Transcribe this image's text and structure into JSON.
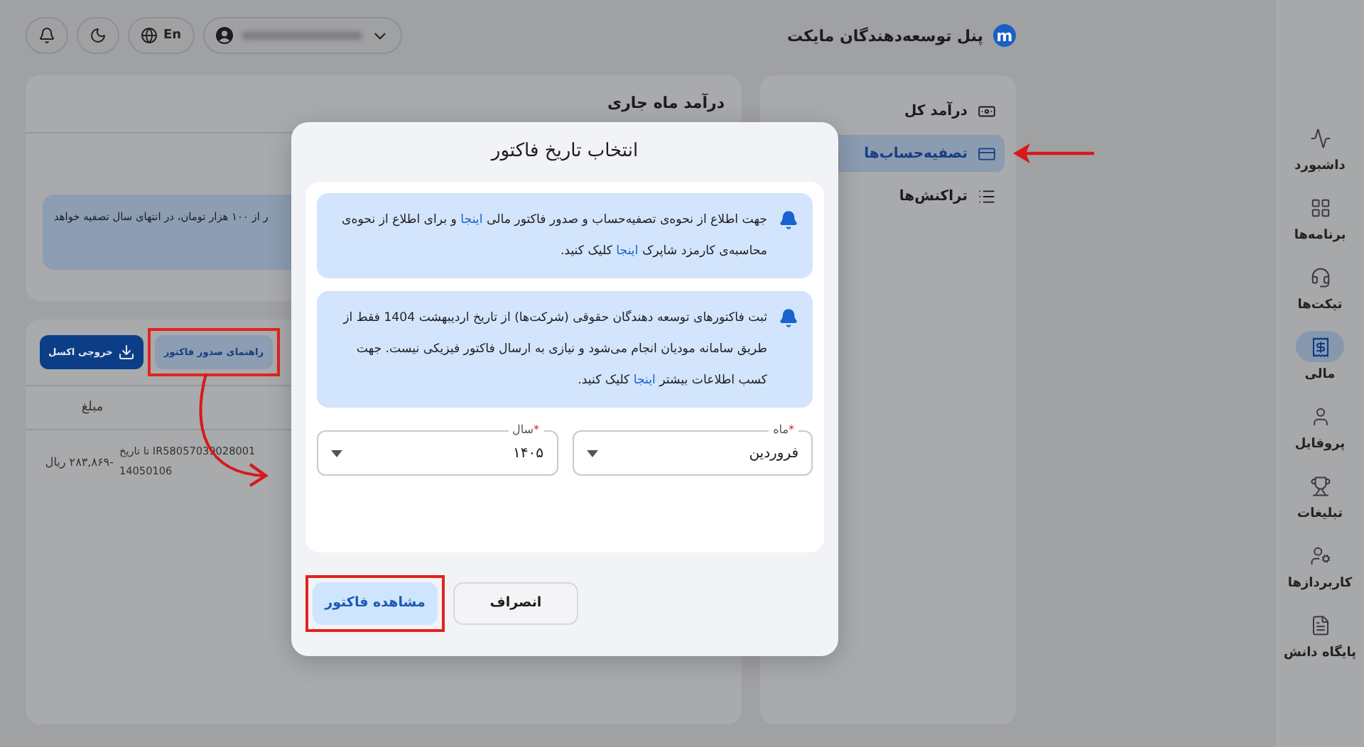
{
  "header": {
    "logo_letter": "m",
    "brand": "پنل توسعه‌دهندگان مایکت",
    "language": "En"
  },
  "nav": {
    "items": [
      {
        "label": "داشبورد",
        "selected": false
      },
      {
        "label": "برنامه‌ها",
        "selected": false
      },
      {
        "label": "تیکت‌ها",
        "selected": false
      },
      {
        "label": "مالی",
        "selected": true
      },
      {
        "label": "پروفایل",
        "selected": false
      },
      {
        "label": "تبلیغات",
        "selected": false
      },
      {
        "label": "کاربردازها",
        "selected": false
      },
      {
        "label": "پایگاه دانش",
        "selected": false
      }
    ]
  },
  "submenu": {
    "items": [
      {
        "label": "درآمد کل",
        "selected": false,
        "annotated": false
      },
      {
        "label": "تصفیه‌حساب‌ها",
        "selected": true,
        "annotated": true
      },
      {
        "label": "تراکنش‌ها",
        "selected": false,
        "annotated": false
      }
    ]
  },
  "income_card": {
    "title": "درآمد ماه جاری",
    "notice": "ر از ۱۰۰ هزار تومان، در انتهای سال تصفیه خواهد"
  },
  "settlements": {
    "buttons": [
      {
        "label": "راهنمای صدور فاکتور",
        "kind": "secondary",
        "highlighted": true
      },
      {
        "label": "خروجی اکسل",
        "kind": "primary",
        "highlighted": false
      }
    ],
    "columns": [
      "مبلغ"
    ],
    "rows": [
      {
        "description": [
          "IR58057039028001 تا تاریخ",
          "14050106"
        ],
        "amount": "-۲۸۳,۸۶۹ ریال"
      }
    ]
  },
  "dialog": {
    "title": "انتخاب تاریخ فاکتور",
    "alerts": [
      {
        "parts": [
          {
            "text": "جهت اطلاع از نحوه‌ی تصفیه‌حساب و صدور فاکتور مالی ",
            "link": false
          },
          {
            "text": "اینجا",
            "link": true
          },
          {
            "text": " و برای اطلاع از نحوه‌ی محاسبه‌ی کارمزد شاپرک ",
            "link": false
          },
          {
            "text": "اینجا",
            "link": true
          },
          {
            "text": " کلیک کنید.",
            "link": false
          }
        ]
      },
      {
        "parts": [
          {
            "text": "ثبت فاکتورهای توسعه دهندگان حقوقی (شرکت‌ها) از تاریخ اردیبهشت 1404 فقط از طریق سامانه مودیان انجام می‌شود و نیازی به ارسال فاکتور فیزیکی نیست. جهت کسب اطلاعات بیشتر ",
            "link": false
          },
          {
            "text": "اینجا",
            "link": true
          },
          {
            "text": " کلیک کنید.",
            "link": false
          }
        ]
      }
    ],
    "selects": [
      {
        "label": "ماه",
        "required_mark": "*",
        "value": "فروردین"
      },
      {
        "label": "سال",
        "required_mark": "*",
        "value": "۱۴۰۵"
      }
    ],
    "buttons": [
      {
        "label": "انصراف",
        "kind": "secondary",
        "highlighted": false
      },
      {
        "label": "مشاهده فاکتور",
        "kind": "primary",
        "highlighted": true
      }
    ]
  }
}
